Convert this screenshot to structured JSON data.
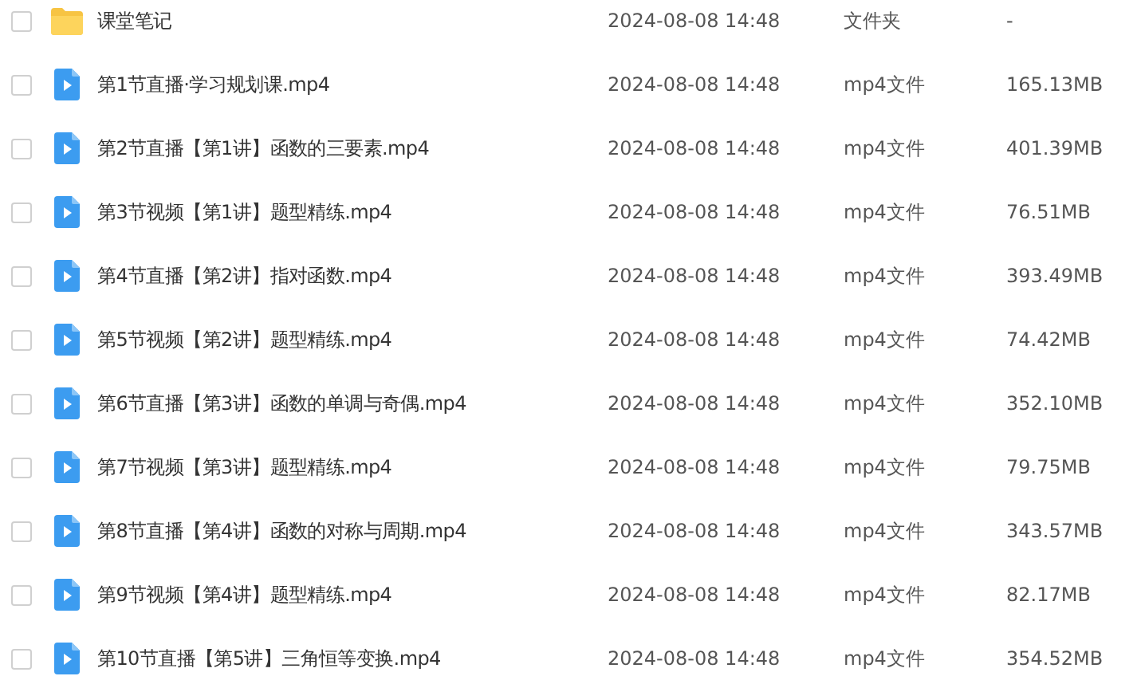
{
  "files": [
    {
      "kind": "folder",
      "name": "课堂笔记",
      "date": "2024-08-08 14:48",
      "type": "文件夹",
      "size": "-",
      "checked": false
    },
    {
      "kind": "video",
      "name": "第1节直播·学习规划课.mp4",
      "date": "2024-08-08 14:48",
      "type": "mp4文件",
      "size": "165.13MB",
      "checked": false
    },
    {
      "kind": "video",
      "name": "第2节直播【第1讲】函数的三要素.mp4",
      "date": "2024-08-08 14:48",
      "type": "mp4文件",
      "size": "401.39MB",
      "checked": false
    },
    {
      "kind": "video",
      "name": "第3节视频【第1讲】题型精练.mp4",
      "date": "2024-08-08 14:48",
      "type": "mp4文件",
      "size": "76.51MB",
      "checked": false
    },
    {
      "kind": "video",
      "name": "第4节直播【第2讲】指对函数.mp4",
      "date": "2024-08-08 14:48",
      "type": "mp4文件",
      "size": "393.49MB",
      "checked": false
    },
    {
      "kind": "video",
      "name": "第5节视频【第2讲】题型精练.mp4",
      "date": "2024-08-08 14:48",
      "type": "mp4文件",
      "size": "74.42MB",
      "checked": false
    },
    {
      "kind": "video",
      "name": "第6节直播【第3讲】函数的单调与奇偶.mp4",
      "date": "2024-08-08 14:48",
      "type": "mp4文件",
      "size": "352.10MB",
      "checked": false
    },
    {
      "kind": "video",
      "name": "第7节视频【第3讲】题型精练.mp4",
      "date": "2024-08-08 14:48",
      "type": "mp4文件",
      "size": "79.75MB",
      "checked": false
    },
    {
      "kind": "video",
      "name": "第8节直播【第4讲】函数的对称与周期.mp4",
      "date": "2024-08-08 14:48",
      "type": "mp4文件",
      "size": "343.57MB",
      "checked": false
    },
    {
      "kind": "video",
      "name": "第9节视频【第4讲】题型精练.mp4",
      "date": "2024-08-08 14:48",
      "type": "mp4文件",
      "size": "82.17MB",
      "checked": false
    },
    {
      "kind": "video",
      "name": "第10节直播【第5讲】三角恒等变换.mp4",
      "date": "2024-08-08 14:48",
      "type": "mp4文件",
      "size": "354.52MB",
      "checked": false
    }
  ]
}
